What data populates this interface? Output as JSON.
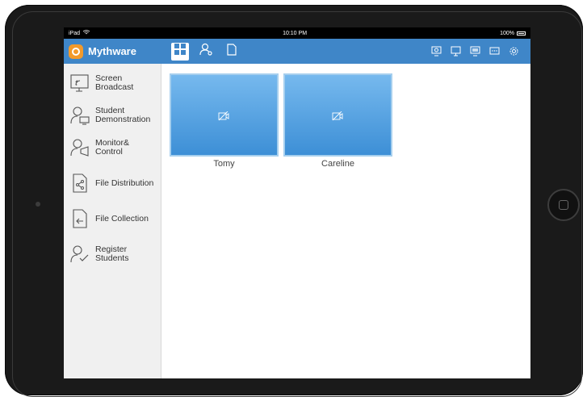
{
  "statusbar": {
    "device": "iPad",
    "time": "10:10 PM",
    "battery": "100%"
  },
  "app": {
    "brand": "Mythware"
  },
  "sidebar": {
    "items": [
      {
        "label": "Screen\nBroadcast",
        "icon": "screen-broadcast-icon"
      },
      {
        "label": "Student\nDemonstration",
        "icon": "student-demonstration-icon"
      },
      {
        "label": "Monitor&\nControl",
        "icon": "monitor-control-icon"
      },
      {
        "label": "File Distribution",
        "icon": "file-distribution-icon"
      },
      {
        "label": "File Collection",
        "icon": "file-collection-icon"
      },
      {
        "label": "Register\nStudents",
        "icon": "register-students-icon"
      }
    ]
  },
  "students": [
    {
      "name": "Tomy"
    },
    {
      "name": "Careline"
    }
  ],
  "colors": {
    "nav": "#3f86c8",
    "tile": "#5aa3e2",
    "logo": "#f39a2b"
  }
}
